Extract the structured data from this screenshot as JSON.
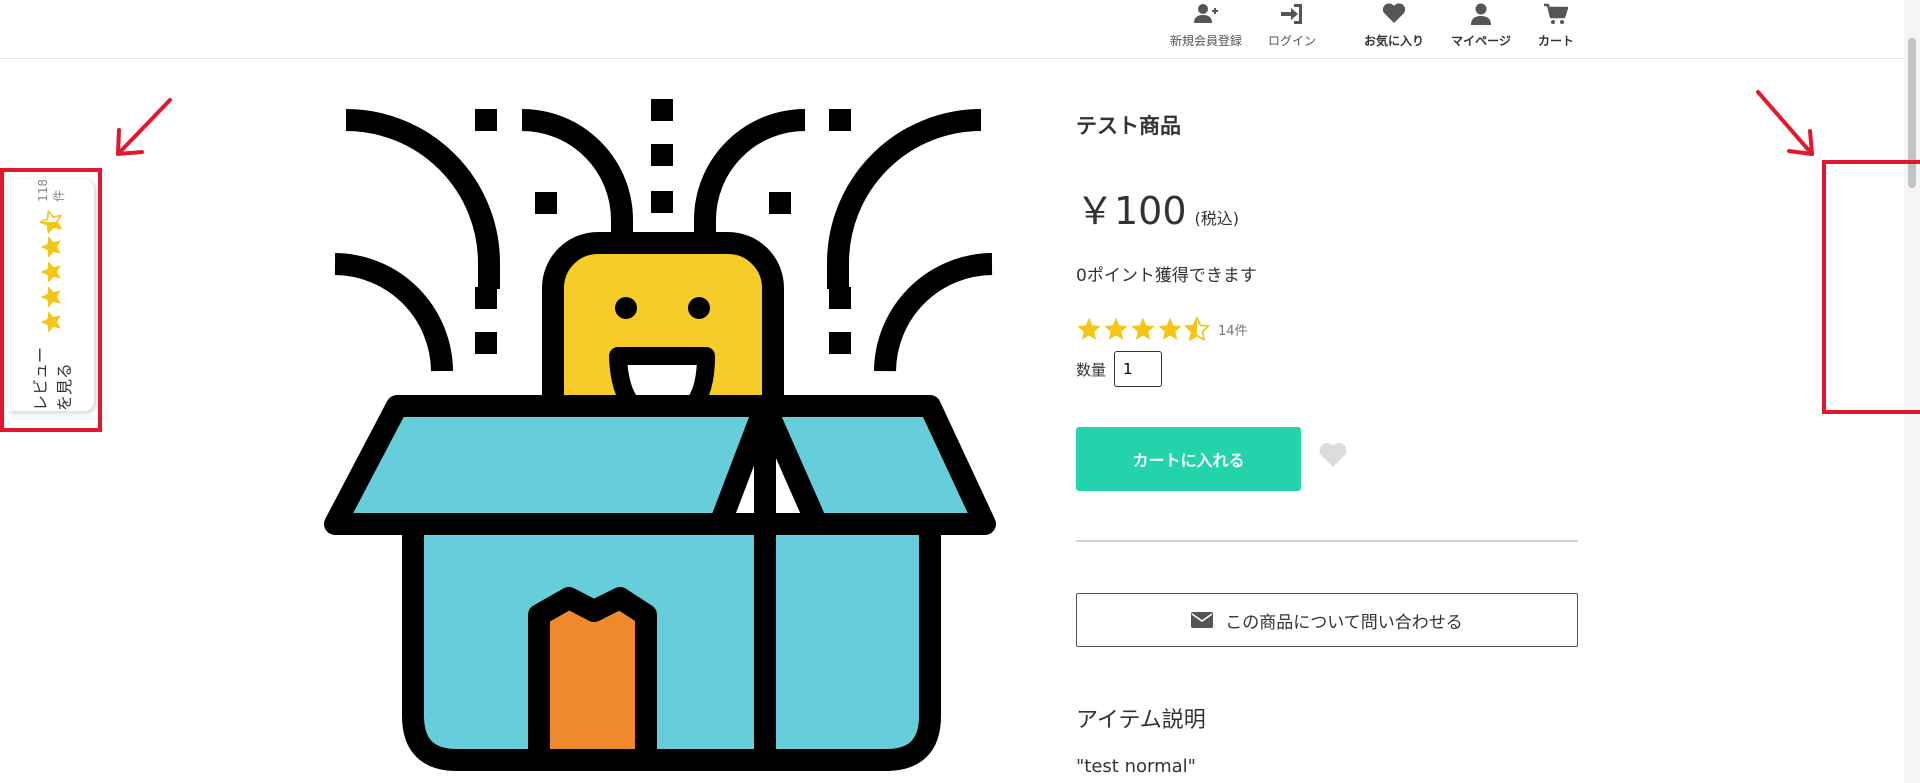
{
  "header": {
    "nav": [
      {
        "label": "新規会員登録",
        "icon": "user-plus-icon"
      },
      {
        "label": "ログイン",
        "icon": "sign-in-icon"
      },
      {
        "label": "お気に入り",
        "icon": "heart-icon"
      },
      {
        "label": "マイページ",
        "icon": "user-icon"
      },
      {
        "label": "カート",
        "icon": "cart-icon"
      }
    ]
  },
  "review_tab": {
    "label": "レビューを見る",
    "count": "118件",
    "rating": 4.5,
    "star_color": "#f5c518"
  },
  "product": {
    "title": "テスト商品",
    "price": "￥100",
    "tax_note": "(税込)",
    "points": "0ポイント獲得できます",
    "rating": 4.5,
    "review_count": "14件",
    "quantity_label": "数量",
    "quantity_value": "1",
    "cart_button": "カートに入れる",
    "contact_button": "この商品について問い合わせる",
    "description_heading": "アイテム説明",
    "description_text": "\"test normal\"",
    "image_icon": "surprise-box-illustration"
  },
  "colors": {
    "accent": "#22d3ab",
    "annotation": "#e2192c",
    "star": "#f5c518"
  }
}
